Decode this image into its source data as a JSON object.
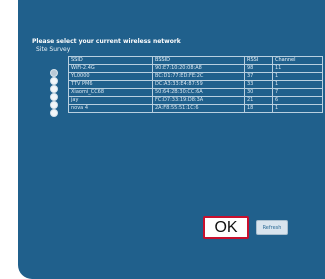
{
  "dialog": {
    "title": "Please select your current wireless network",
    "subtitle": "Site Survey"
  },
  "table": {
    "headers": [
      "SSID",
      "BSSID",
      "RSSI",
      "Channel"
    ],
    "rows": [
      {
        "ssid": "WiFi-2.4G",
        "bssid": "90:E7:10:20:08:A8",
        "rssi": "98",
        "channel": "11",
        "selected": true
      },
      {
        "ssid": "YL0000",
        "bssid": "BC:D1:77:ED:FE:2C",
        "rssi": "37",
        "channel": "1",
        "selected": false
      },
      {
        "ssid": "TTV PM6",
        "bssid": "DC:A3:33:E4:87:59",
        "rssi": "33",
        "channel": "1",
        "selected": false
      },
      {
        "ssid": "Xiaomi_CC68",
        "bssid": "50:64:2B:30:CC:6A",
        "rssi": "30",
        "channel": "7",
        "selected": false
      },
      {
        "ssid": "jay",
        "bssid": "FC:D7:33:19:D8:3A",
        "rssi": "21",
        "channel": "6",
        "selected": false
      },
      {
        "ssid": "nova 4",
        "bssid": "2A:F8:55:51:1C:6",
        "rssi": "18",
        "channel": "1",
        "selected": false
      }
    ]
  },
  "buttons": {
    "ok_label": "OK",
    "refresh_label": "Refresh"
  },
  "colors": {
    "panel_background": "#20608c",
    "ok_border": "#c8102e"
  }
}
